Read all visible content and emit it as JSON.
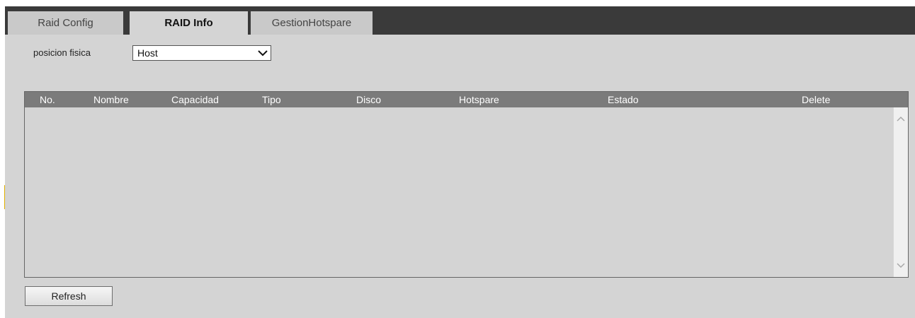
{
  "tabs": [
    {
      "label": "Raid Config",
      "active": false
    },
    {
      "label": "RAID Info",
      "active": true
    },
    {
      "label": "GestionHotspare",
      "active": false
    }
  ],
  "position": {
    "label": "posicion fisica",
    "selected": "Host",
    "dropdown_icon": "chevron-down-icon"
  },
  "table": {
    "columns": [
      "No.",
      "Nombre",
      "Capacidad",
      "Tipo",
      "Disco",
      "Hotspare",
      "Estado",
      "Delete"
    ],
    "rows": []
  },
  "buttons": {
    "refresh": "Refresh"
  },
  "colors": {
    "tabbar_bg": "#3a3a3a",
    "panel_bg": "#d4d4d4",
    "header_bg": "#7b7b7b",
    "accent": "#e0b000"
  }
}
